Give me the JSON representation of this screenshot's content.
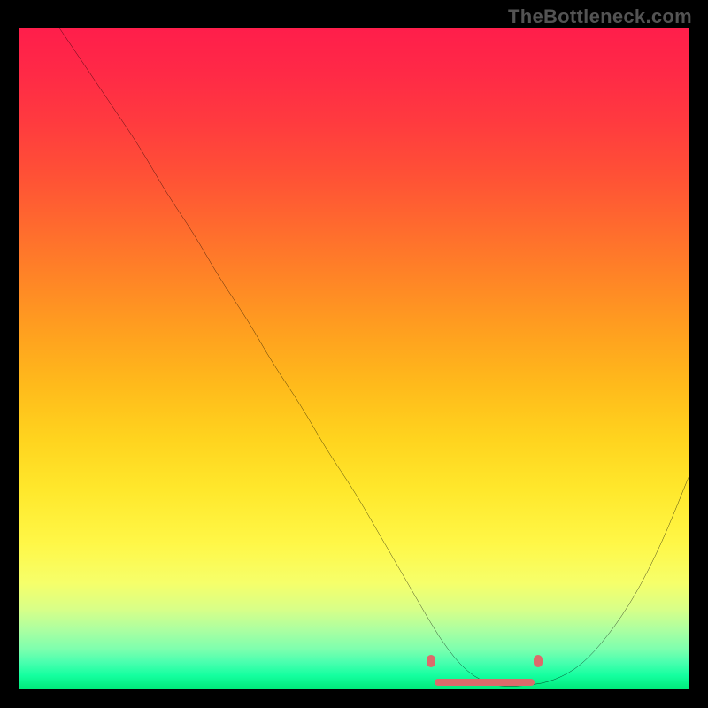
{
  "watermark": "TheBottleneck.com",
  "chart_data": {
    "type": "line",
    "title": "",
    "xlabel": "",
    "ylabel": "",
    "xlim": [
      0,
      100
    ],
    "ylim": [
      0,
      100
    ],
    "grid": false,
    "legend": false,
    "series": [
      {
        "name": "curve",
        "x": [
          6,
          10,
          14,
          18,
          22,
          26,
          30,
          34,
          38,
          42,
          46,
          50,
          54,
          58,
          62,
          64,
          66,
          68,
          70,
          72,
          76,
          80,
          84,
          88,
          92,
          96,
          100
        ],
        "y": [
          100,
          94,
          88,
          82,
          75,
          69,
          62,
          56,
          49,
          43,
          36,
          30,
          23,
          16,
          9,
          6,
          3.5,
          1.8,
          0.8,
          0.3,
          0.4,
          1.2,
          3.5,
          8,
          14,
          22,
          32
        ]
      }
    ],
    "markers": [
      {
        "x": 61.5,
        "y": 4.2
      },
      {
        "x": 77.5,
        "y": 4.2
      }
    ],
    "marker_bar": {
      "x_start": 62,
      "x_end": 77,
      "y": 1.0
    },
    "colors": {
      "curve": "#000000",
      "marker": "#db6b6b",
      "gradient_top": "#ff1e4b",
      "gradient_bottom": "#00eb7b"
    }
  }
}
